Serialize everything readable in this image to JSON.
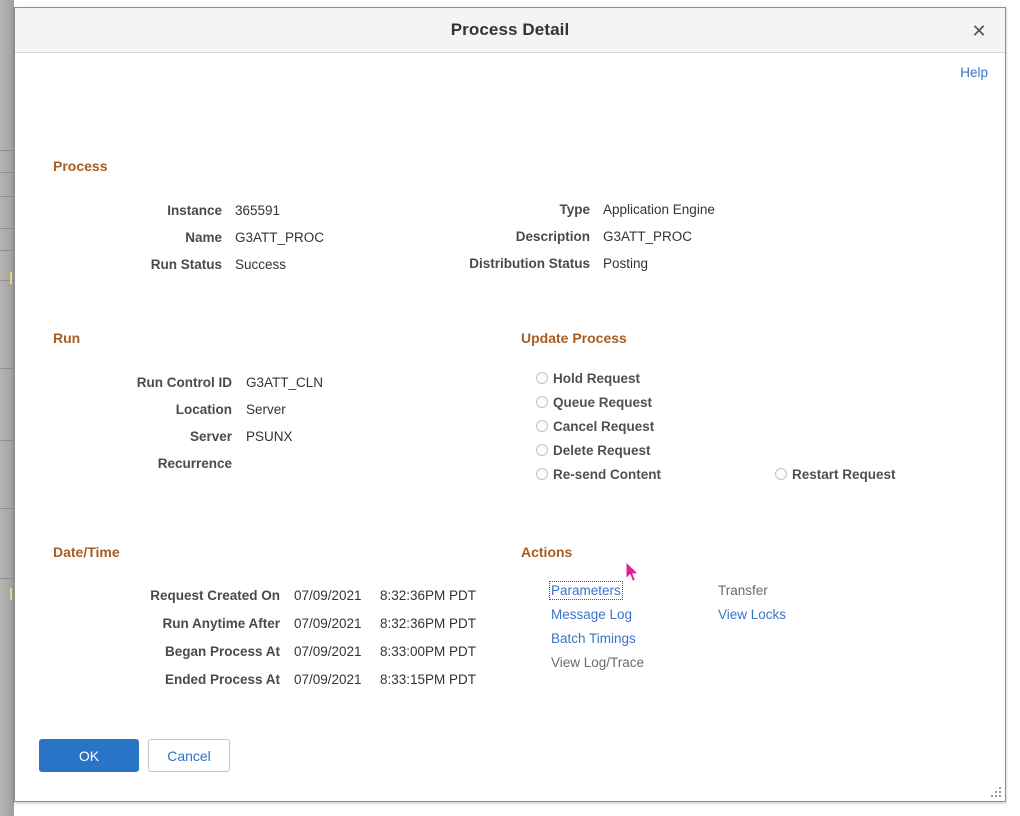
{
  "window": {
    "title": "Process Detail",
    "close_icon": "close-icon",
    "help_label": "Help"
  },
  "sections": {
    "process": {
      "heading": "Process",
      "left_fields": [
        {
          "label": "Instance",
          "value": "365591"
        },
        {
          "label": "Name",
          "value": "G3ATT_PROC"
        },
        {
          "label": "Run Status",
          "value": "Success"
        }
      ],
      "right_fields": [
        {
          "label": "Type",
          "value": "Application Engine"
        },
        {
          "label": "Description",
          "value": "G3ATT_PROC"
        },
        {
          "label": "Distribution Status",
          "value": "Posting"
        }
      ]
    },
    "run": {
      "heading": "Run",
      "fields": [
        {
          "label": "Run Control ID",
          "value": "G3ATT_CLN"
        },
        {
          "label": "Location",
          "value": "Server"
        },
        {
          "label": "Server",
          "value": "PSUNX"
        },
        {
          "label": "Recurrence",
          "value": ""
        }
      ]
    },
    "update_process": {
      "heading": "Update Process",
      "options_left": [
        {
          "label": "Hold Request",
          "selected": false
        },
        {
          "label": "Queue Request",
          "selected": false
        },
        {
          "label": "Cancel Request",
          "selected": false
        },
        {
          "label": "Delete Request",
          "selected": false
        },
        {
          "label": "Re-send Content",
          "selected": false
        }
      ],
      "options_right": [
        {
          "label": "Restart Request",
          "selected": false
        }
      ]
    },
    "datetime": {
      "heading": "Date/Time",
      "rows": [
        {
          "label": "Request Created On",
          "date": "07/09/2021",
          "time": "8:32:36PM PDT"
        },
        {
          "label": "Run Anytime After",
          "date": "07/09/2021",
          "time": "8:32:36PM PDT"
        },
        {
          "label": "Began Process At",
          "date": "07/09/2021",
          "time": "8:33:00PM PDT"
        },
        {
          "label": "Ended Process At",
          "date": "07/09/2021",
          "time": "8:33:15PM PDT"
        }
      ]
    },
    "actions": {
      "heading": "Actions",
      "links_left": [
        {
          "label": "Parameters",
          "enabled": true,
          "focused": true
        },
        {
          "label": "Message Log",
          "enabled": true,
          "focused": false
        },
        {
          "label": "Batch Timings",
          "enabled": true,
          "focused": false
        },
        {
          "label": "View Log/Trace",
          "enabled": false,
          "focused": false
        }
      ],
      "links_right": [
        {
          "label": "Transfer",
          "enabled": false,
          "focused": false
        },
        {
          "label": "View Locks",
          "enabled": true,
          "focused": false
        }
      ]
    }
  },
  "footer": {
    "ok_label": "OK",
    "cancel_label": "Cancel"
  },
  "colors": {
    "section_heading": "#a85d22",
    "link": "#3a74c8",
    "primary_button": "#2a74c8",
    "title_bar": "#f4f4f4",
    "cursor": "#e8199b"
  }
}
